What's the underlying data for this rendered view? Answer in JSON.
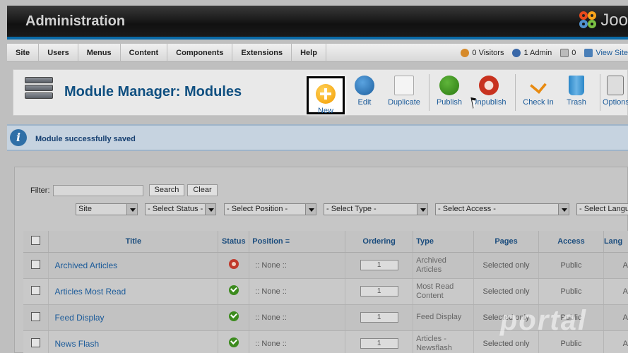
{
  "header": {
    "title": "Administration",
    "logo_text": "Joo"
  },
  "menu": {
    "items": [
      "Site",
      "Users",
      "Menus",
      "Content",
      "Components",
      "Extensions",
      "Help"
    ]
  },
  "status": {
    "visitors": "0 Visitors",
    "admins": "1 Admin",
    "messages": "0",
    "view_site": "View Site"
  },
  "toolbar": {
    "page_title": "Module Manager: Modules",
    "new_label": "New",
    "edit_label": "Edit",
    "duplicate_label": "Duplicate",
    "publish_label": "Publish",
    "unpublish_label": "Unpublish",
    "checkin_label": "Check In",
    "trash_label": "Trash",
    "options_label": "Options"
  },
  "message": {
    "text": "Module successfully saved"
  },
  "filter": {
    "label": "Filter:",
    "search_button": "Search",
    "clear_button": "Clear",
    "selects": [
      "Site",
      "- Select Status -",
      "- Select Position -",
      "- Select Type -",
      "- Select Access -",
      "- Select Language -"
    ]
  },
  "table": {
    "headers": {
      "title": "Title",
      "status": "Status",
      "position": "Position",
      "ordering": "Ordering",
      "type": "Type",
      "pages": "Pages",
      "access": "Access",
      "language": "Lang"
    },
    "rows": [
      {
        "title": "Archived Articles",
        "status": "unpublished",
        "position": ":: None ::",
        "ordering": "1",
        "type": "Archived Articles",
        "pages": "Selected only",
        "access": "Public",
        "language": "A"
      },
      {
        "title": "Articles Most Read",
        "status": "published",
        "position": ":: None ::",
        "ordering": "1",
        "type": "Most Read Content",
        "pages": "Selected only",
        "access": "Public",
        "language": "A"
      },
      {
        "title": "Feed Display",
        "status": "published",
        "position": ":: None ::",
        "ordering": "1",
        "type": "Feed Display",
        "pages": "Selected only",
        "access": "Public",
        "language": "A"
      },
      {
        "title": "News Flash",
        "status": "published",
        "position": ":: None ::",
        "ordering": "1",
        "type": "Articles - Newsflash",
        "pages": "Selected only",
        "access": "Public",
        "language": "A"
      }
    ]
  },
  "watermark": {
    "text": "portal",
    "sub": ""
  }
}
